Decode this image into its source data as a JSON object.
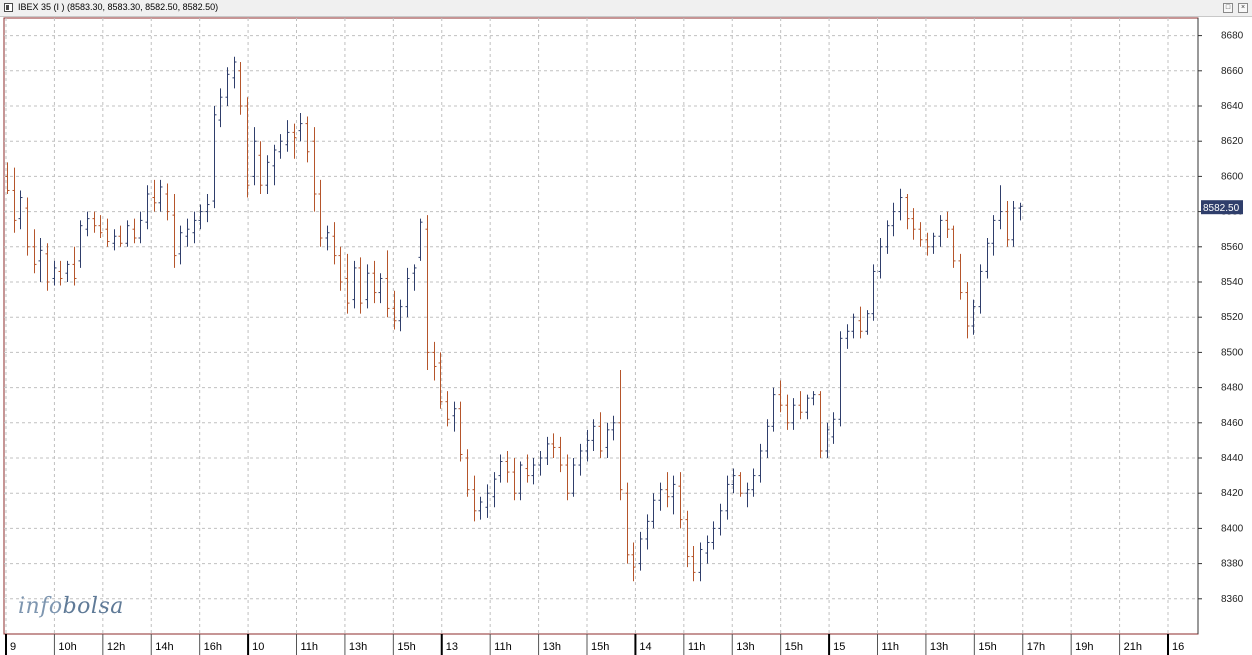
{
  "window": {
    "title": "IBEX 35 (I ) (8583.30, 8583.30, 8582.50, 8582.50)"
  },
  "watermark": {
    "part1": "info",
    "part2": "bolsa"
  },
  "colors": {
    "up": "#2f3e6b",
    "down": "#b5552b",
    "grid": "#c0c0c0",
    "frame": "#8c2b2b",
    "price_tag_bg": "#2f3e6b"
  },
  "chart_data": {
    "type": "ohlc",
    "title": "IBEX 35 (I )",
    "ylim": [
      8340,
      8690
    ],
    "yticks": [
      8360,
      8380,
      8400,
      8420,
      8440,
      8460,
      8480,
      8500,
      8520,
      8540,
      8560,
      8580,
      8600,
      8620,
      8640,
      8660,
      8680
    ],
    "grid": true,
    "last_price": "8582.50",
    "x_tick_labels": [
      "9",
      "10h",
      "12h",
      "14h",
      "16h",
      "10",
      "11h",
      "13h",
      "15h",
      "13",
      "11h",
      "13h",
      "15h",
      "14",
      "11h",
      "13h",
      "15h",
      "15",
      "11h",
      "13h",
      "15h",
      "17h",
      "19h",
      "21h",
      "16"
    ],
    "x_tick_major": [
      true,
      false,
      false,
      false,
      false,
      true,
      false,
      false,
      false,
      true,
      false,
      false,
      false,
      true,
      false,
      false,
      false,
      true,
      false,
      false,
      false,
      false,
      false,
      false,
      true
    ],
    "bars": [
      [
        8600,
        8608,
        8590,
        8592
      ],
      [
        8592,
        8605,
        8568,
        8575
      ],
      [
        8576,
        8592,
        8570,
        8588
      ],
      [
        8582,
        8588,
        8555,
        8560
      ],
      [
        8560,
        8570,
        8545,
        8550
      ],
      [
        8552,
        8565,
        8540,
        8558
      ],
      [
        8556,
        8562,
        8535,
        8540
      ],
      [
        8542,
        8552,
        8538,
        8548
      ],
      [
        8546,
        8552,
        8538,
        8542
      ],
      [
        8545,
        8552,
        8540,
        8550
      ],
      [
        8550,
        8560,
        8538,
        8542
      ],
      [
        8552,
        8575,
        8548,
        8572
      ],
      [
        8570,
        8580,
        8566,
        8576
      ],
      [
        8576,
        8580,
        8568,
        8572
      ],
      [
        8572,
        8578,
        8565,
        8568
      ],
      [
        8570,
        8576,
        8560,
        8563
      ],
      [
        8562,
        8570,
        8558,
        8566
      ],
      [
        8566,
        8572,
        8560,
        8562
      ],
      [
        8562,
        8575,
        8560,
        8572
      ],
      [
        8570,
        8576,
        8562,
        8565
      ],
      [
        8565,
        8580,
        8562,
        8575
      ],
      [
        8574,
        8595,
        8570,
        8590
      ],
      [
        8588,
        8598,
        8580,
        8585
      ],
      [
        8585,
        8598,
        8580,
        8594
      ],
      [
        8590,
        8596,
        8575,
        8580
      ],
      [
        8578,
        8590,
        8548,
        8555
      ],
      [
        8556,
        8572,
        8550,
        8568
      ],
      [
        8566,
        8576,
        8560,
        8570
      ],
      [
        8568,
        8580,
        8562,
        8575
      ],
      [
        8575,
        8584,
        8570,
        8580
      ],
      [
        8580,
        8590,
        8574,
        8584
      ],
      [
        8586,
        8640,
        8582,
        8635
      ],
      [
        8632,
        8650,
        8628,
        8645
      ],
      [
        8645,
        8662,
        8640,
        8658
      ],
      [
        8656,
        8668,
        8650,
        8665
      ],
      [
        8660,
        8665,
        8635,
        8640
      ],
      [
        8640,
        8645,
        8588,
        8595
      ],
      [
        8600,
        8628,
        8595,
        8620
      ],
      [
        8612,
        8620,
        8590,
        8595
      ],
      [
        8595,
        8612,
        8590,
        8608
      ],
      [
        8606,
        8618,
        8595,
        8615
      ],
      [
        8614,
        8624,
        8610,
        8620
      ],
      [
        8618,
        8632,
        8614,
        8625
      ],
      [
        8625,
        8630,
        8610,
        8622
      ],
      [
        8626,
        8636,
        8620,
        8630
      ],
      [
        8630,
        8634,
        8608,
        8614
      ],
      [
        8620,
        8628,
        8580,
        8590
      ],
      [
        8590,
        8598,
        8560,
        8565
      ],
      [
        8565,
        8572,
        8558,
        8568
      ],
      [
        8566,
        8574,
        8550,
        8555
      ],
      [
        8555,
        8560,
        8535,
        8540
      ],
      [
        8542,
        8556,
        8522,
        8528
      ],
      [
        8530,
        8552,
        8525,
        8548
      ],
      [
        8548,
        8554,
        8522,
        8528
      ],
      [
        8530,
        8550,
        8525,
        8545
      ],
      [
        8545,
        8552,
        8528,
        8534
      ],
      [
        8534,
        8545,
        8528,
        8542
      ],
      [
        8542,
        8558,
        8520,
        8525
      ],
      [
        8525,
        8535,
        8513,
        8518
      ],
      [
        8518,
        8530,
        8512,
        8526
      ],
      [
        8526,
        8548,
        8520,
        8542
      ],
      [
        8545,
        8550,
        8535,
        8548
      ],
      [
        8554,
        8576,
        8552,
        8574
      ],
      [
        8570,
        8578,
        8490,
        8500
      ],
      [
        8500,
        8506,
        8484,
        8492
      ],
      [
        8494,
        8500,
        8468,
        8472
      ],
      [
        8472,
        8478,
        8458,
        8462
      ],
      [
        8464,
        8472,
        8455,
        8468
      ],
      [
        8468,
        8472,
        8438,
        8442
      ],
      [
        8440,
        8445,
        8418,
        8422
      ],
      [
        8422,
        8430,
        8404,
        8410
      ],
      [
        8410,
        8418,
        8405,
        8415
      ],
      [
        8412,
        8425,
        8406,
        8420
      ],
      [
        8418,
        8432,
        8412,
        8428
      ],
      [
        8430,
        8442,
        8426,
        8438
      ],
      [
        8438,
        8444,
        8426,
        8432
      ],
      [
        8432,
        8440,
        8416,
        8420
      ],
      [
        8420,
        8438,
        8416,
        8436
      ],
      [
        8434,
        8442,
        8426,
        8430
      ],
      [
        8430,
        8440,
        8425,
        8436
      ],
      [
        8436,
        8444,
        8430,
        8440
      ],
      [
        8440,
        8452,
        8436,
        8448
      ],
      [
        8448,
        8454,
        8440,
        8446
      ],
      [
        8446,
        8452,
        8432,
        8436
      ],
      [
        8436,
        8442,
        8416,
        8420
      ],
      [
        8420,
        8440,
        8418,
        8436
      ],
      [
        8436,
        8448,
        8430,
        8444
      ],
      [
        8444,
        8456,
        8438,
        8450
      ],
      [
        8450,
        8462,
        8444,
        8458
      ],
      [
        8458,
        8466,
        8440,
        8444
      ],
      [
        8446,
        8460,
        8440,
        8456
      ],
      [
        8456,
        8464,
        8450,
        8460
      ],
      [
        8460,
        8490,
        8416,
        8422
      ],
      [
        8420,
        8426,
        8380,
        8385
      ],
      [
        8385,
        8392,
        8370,
        8378
      ],
      [
        8380,
        8398,
        8376,
        8394
      ],
      [
        8394,
        8408,
        8388,
        8404
      ],
      [
        8404,
        8420,
        8400,
        8416
      ],
      [
        8416,
        8426,
        8410,
        8422
      ],
      [
        8422,
        8432,
        8412,
        8418
      ],
      [
        8418,
        8430,
        8408,
        8425
      ],
      [
        8424,
        8432,
        8400,
        8405
      ],
      [
        8405,
        8410,
        8378,
        8384
      ],
      [
        8384,
        8390,
        8370,
        8375
      ],
      [
        8375,
        8392,
        8370,
        8388
      ],
      [
        8386,
        8396,
        8380,
        8392
      ],
      [
        8392,
        8404,
        8388,
        8400
      ],
      [
        8400,
        8414,
        8396,
        8410
      ],
      [
        8410,
        8430,
        8405,
        8425
      ],
      [
        8425,
        8434,
        8420,
        8430
      ],
      [
        8430,
        8432,
        8418,
        8420
      ],
      [
        8420,
        8426,
        8412,
        8422
      ],
      [
        8422,
        8434,
        8418,
        8430
      ],
      [
        8430,
        8448,
        8426,
        8444
      ],
      [
        8444,
        8462,
        8440,
        8458
      ],
      [
        8458,
        8480,
        8455,
        8476
      ],
      [
        8476,
        8484,
        8466,
        8470
      ],
      [
        8470,
        8476,
        8456,
        8460
      ],
      [
        8460,
        8474,
        8456,
        8470
      ],
      [
        8470,
        8478,
        8462,
        8466
      ],
      [
        8466,
        8476,
        8462,
        8474
      ],
      [
        8474,
        8478,
        8470,
        8476
      ],
      [
        8476,
        8478,
        8440,
        8444
      ],
      [
        8444,
        8460,
        8440,
        8456
      ],
      [
        8452,
        8466,
        8448,
        8462
      ],
      [
        8462,
        8512,
        8458,
        8508
      ],
      [
        8508,
        8516,
        8502,
        8512
      ],
      [
        8512,
        8522,
        8508,
        8520
      ],
      [
        8518,
        8526,
        8508,
        8512
      ],
      [
        8512,
        8524,
        8510,
        8522
      ],
      [
        8522,
        8550,
        8518,
        8546
      ],
      [
        8546,
        8565,
        8542,
        8560
      ],
      [
        8560,
        8575,
        8556,
        8572
      ],
      [
        8572,
        8585,
        8566,
        8580
      ],
      [
        8580,
        8593,
        8575,
        8588
      ],
      [
        8588,
        8590,
        8570,
        8576
      ],
      [
        8576,
        8582,
        8564,
        8570
      ],
      [
        8570,
        8574,
        8560,
        8564
      ],
      [
        8564,
        8568,
        8555,
        8560
      ],
      [
        8560,
        8568,
        8556,
        8566
      ],
      [
        8566,
        8578,
        8560,
        8575
      ],
      [
        8575,
        8580,
        8565,
        8570
      ],
      [
        8570,
        8572,
        8548,
        8552
      ],
      [
        8552,
        8556,
        8530,
        8534
      ],
      [
        8534,
        8540,
        8508,
        8515
      ],
      [
        8515,
        8530,
        8510,
        8526
      ],
      [
        8526,
        8550,
        8522,
        8546
      ],
      [
        8546,
        8565,
        8542,
        8562
      ],
      [
        8562,
        8578,
        8555,
        8575
      ],
      [
        8575,
        8595,
        8570,
        8580
      ],
      [
        8580,
        8586,
        8560,
        8564
      ],
      [
        8564,
        8586,
        8560,
        8582
      ],
      [
        8582,
        8585,
        8575,
        8583
      ]
    ]
  }
}
